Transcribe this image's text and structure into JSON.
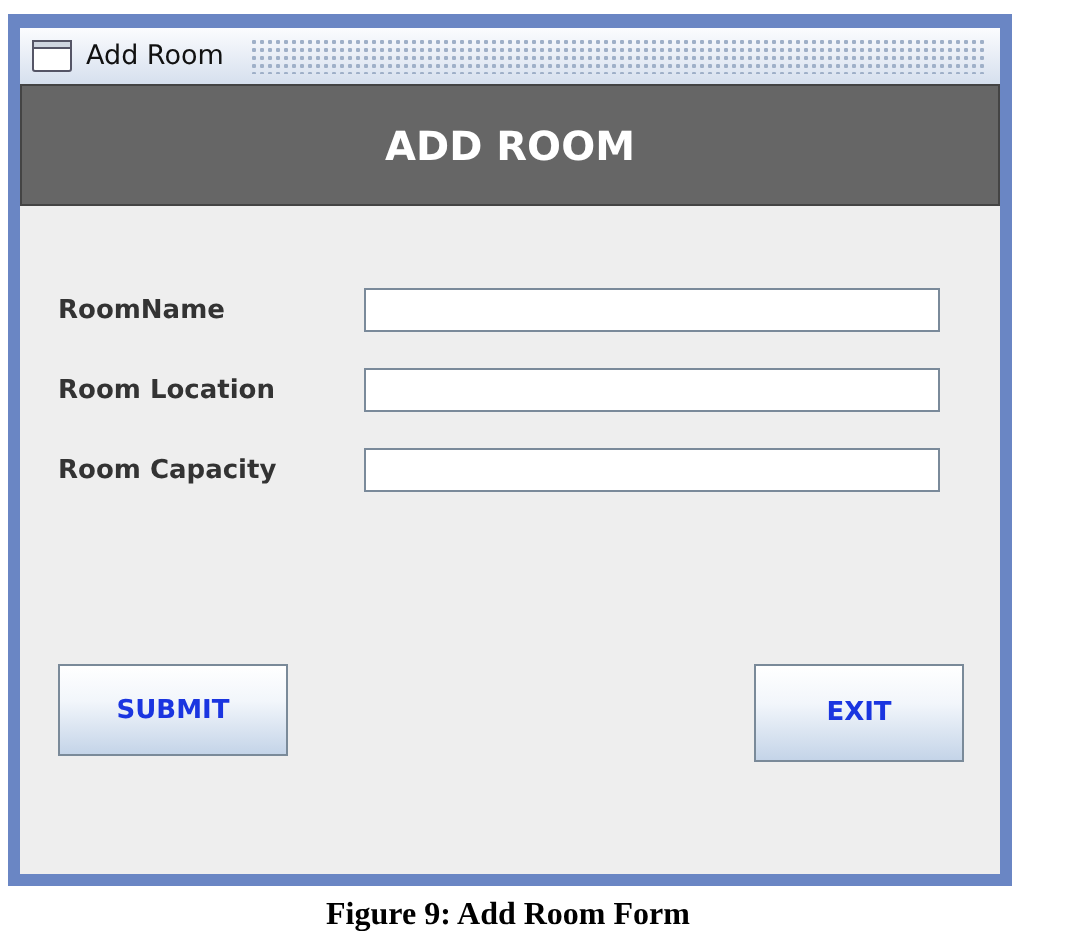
{
  "window": {
    "title": "Add Room"
  },
  "header": "ADD ROOM",
  "fields": [
    {
      "label": "RoomName"
    },
    {
      "label": "Room Location"
    },
    {
      "label": "Room Capacity"
    }
  ],
  "buttons": [
    {
      "label": "SUBMIT"
    },
    {
      "label": "EXIT"
    }
  ],
  "caption": "Figure 9: Add Room Form"
}
